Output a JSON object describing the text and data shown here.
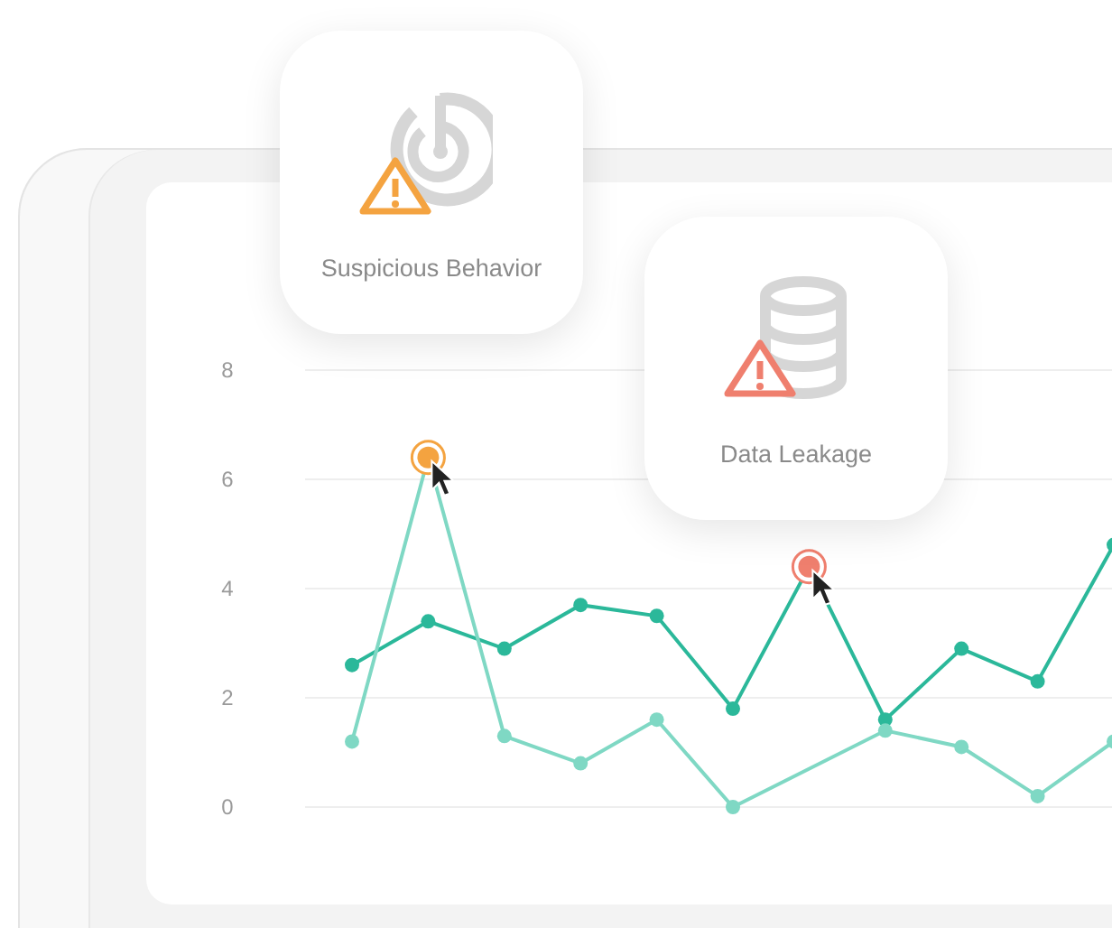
{
  "alerts": [
    {
      "kind": "behavior",
      "label": "Suspicious Behavior",
      "color": "#f4a340"
    },
    {
      "kind": "leakage",
      "label": "Data Leakage",
      "color": "#ef7f6e"
    }
  ],
  "chart_data": {
    "type": "line",
    "ylim": [
      0,
      8
    ],
    "yticks": [
      0,
      2,
      4,
      6,
      8
    ],
    "grid": true,
    "series": [
      {
        "color": "#2bb89a",
        "marker": true,
        "values": [
          2.6,
          3.4,
          2.9,
          3.7,
          3.5,
          1.8,
          4.4,
          1.6,
          2.9,
          2.3,
          4.8
        ]
      },
      {
        "color": "#7fd8c4",
        "marker": true,
        "values": [
          1.2,
          6.4,
          1.3,
          0.8,
          1.6,
          0,
          null,
          1.4,
          1.1,
          0.2,
          1.2
        ]
      }
    ]
  }
}
